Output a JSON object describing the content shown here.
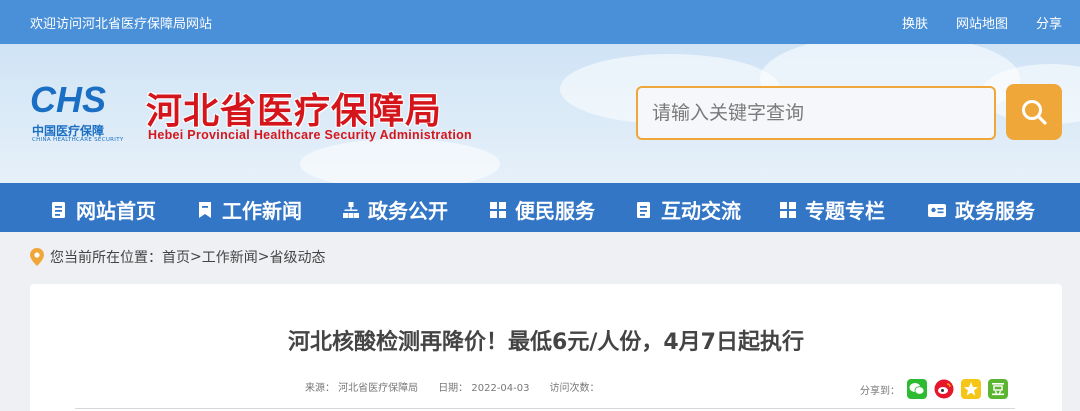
{
  "topbar": {
    "welcome": "欢迎访问河北省医疗保障局网站",
    "links": [
      "换肤",
      "网站地图",
      "分享"
    ]
  },
  "header": {
    "logo_letters": "CHS",
    "logo_cn": "中国医疗保障",
    "logo_en": "CHINA HEALTHCARE SECURITY",
    "title": "河北省医疗保障局",
    "subtitle": "Hebei Provincial Healthcare Security Administration",
    "search_placeholder": "请输入关键字查询"
  },
  "nav": {
    "items": [
      "网站首页",
      "工作新闻",
      "政务公开",
      "便民服务",
      "互动交流",
      "专题专栏",
      "政务服务"
    ]
  },
  "breadcrumb": {
    "prefix": "您当前所在位置：",
    "home": "首页",
    "sep1": ">",
    "level1": "工作新闻",
    "sep2": ">",
    "level2": "省级动态"
  },
  "article": {
    "title": "河北核酸检测再降价！最低6元/人份，4月7日起执行",
    "source": "来源：  河北省医疗保障局",
    "date": "日期：  2022-04-03",
    "visits": "访问次数：",
    "share_label": "分享到："
  },
  "colors": {
    "topbar": "#4a90d9",
    "nav": "#3376c6",
    "accent": "#f0a73a",
    "brand_red": "#d4161c"
  }
}
